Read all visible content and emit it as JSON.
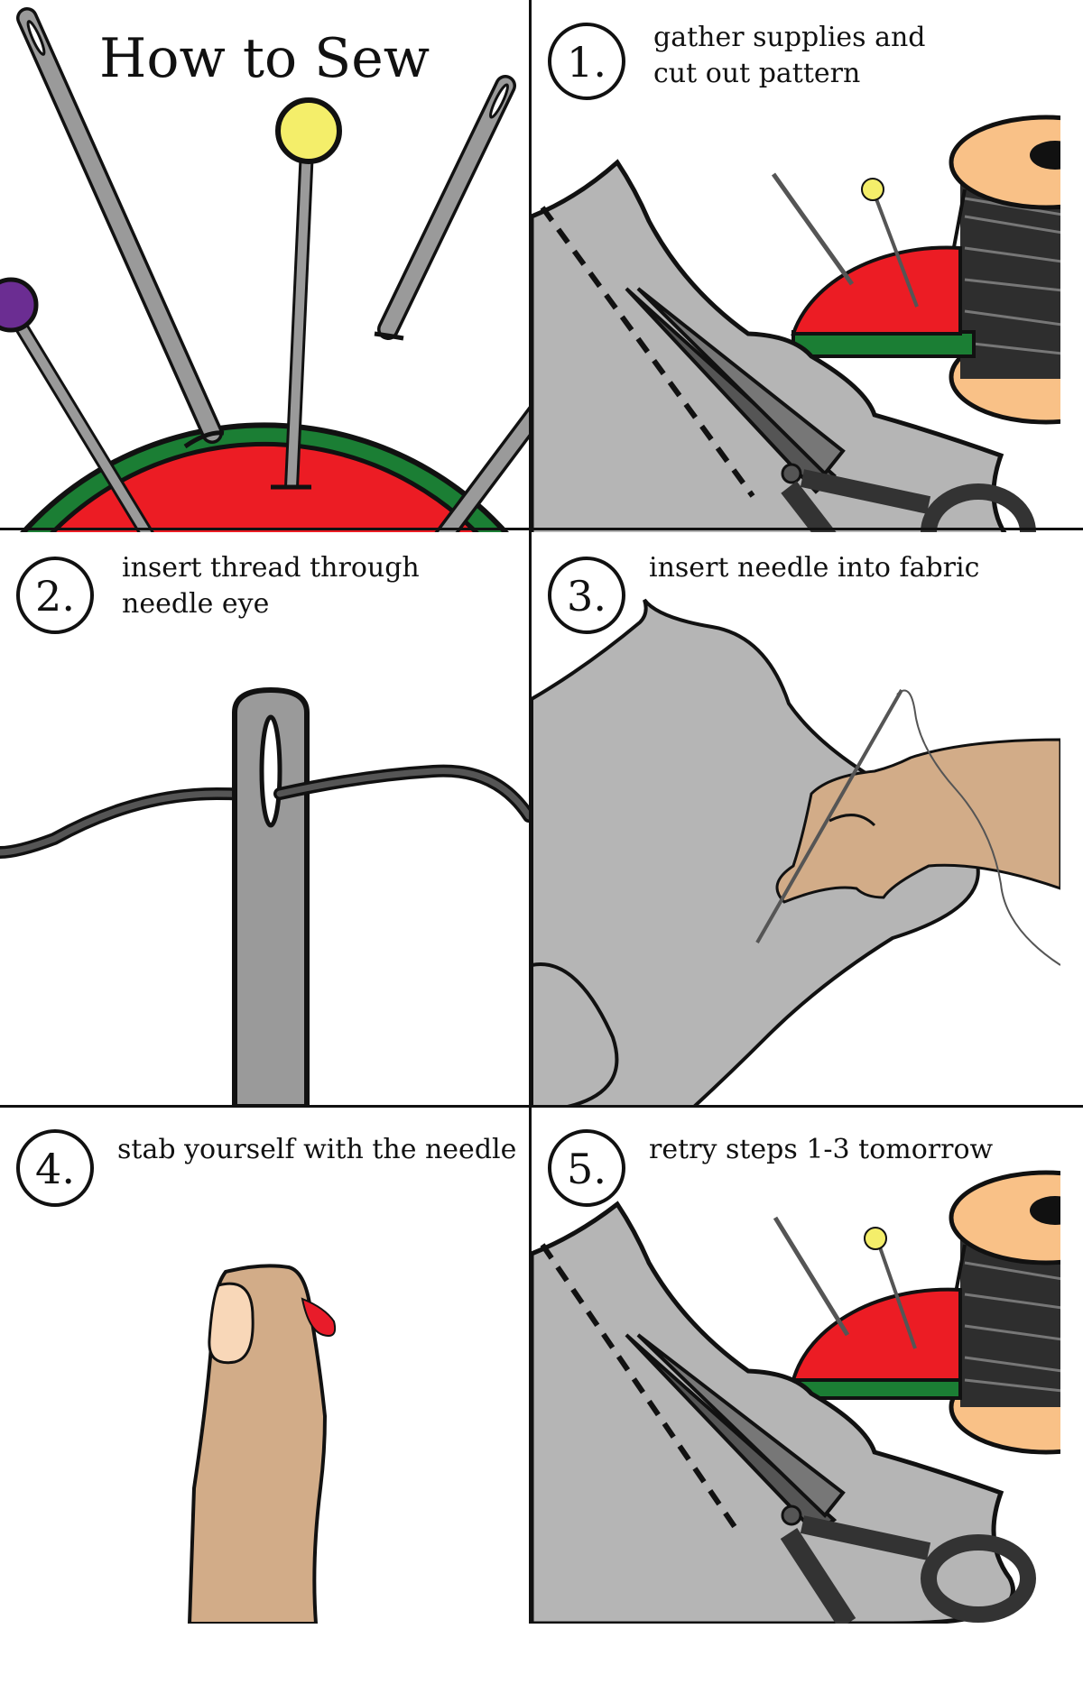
{
  "title": "How to Sew",
  "steps": [
    {
      "num": "1.",
      "text": "gather supplies and\ncut out pattern"
    },
    {
      "num": "2.",
      "text": "insert thread through\nneedle eye"
    },
    {
      "num": "3.",
      "text": "insert needle into fabric"
    },
    {
      "num": "4.",
      "text": "stab yourself with the needle"
    },
    {
      "num": "5.",
      "text": "retry steps 1-3 tomorrow"
    }
  ],
  "colors": {
    "cushion_red": "#ec1c24",
    "cushion_green": "#1b7e34",
    "fabric_gray": "#b5b5b5",
    "needle_gray": "#9a9a9a",
    "pin_yellow": "#f4ee6a",
    "pin_purple": "#6b2d92",
    "spool_wood": "#f9c187",
    "skin": "#d2ac88",
    "nail": "#f8d7b8",
    "blood": "#e81c2a",
    "thread_dark": "#2e2e2e"
  },
  "icons": [
    "pincushion-icon",
    "needle-icon",
    "pin-icon",
    "spool-icon",
    "scissors-icon",
    "fabric-icon",
    "hand-icon",
    "finger-icon",
    "blood-drop-icon"
  ]
}
